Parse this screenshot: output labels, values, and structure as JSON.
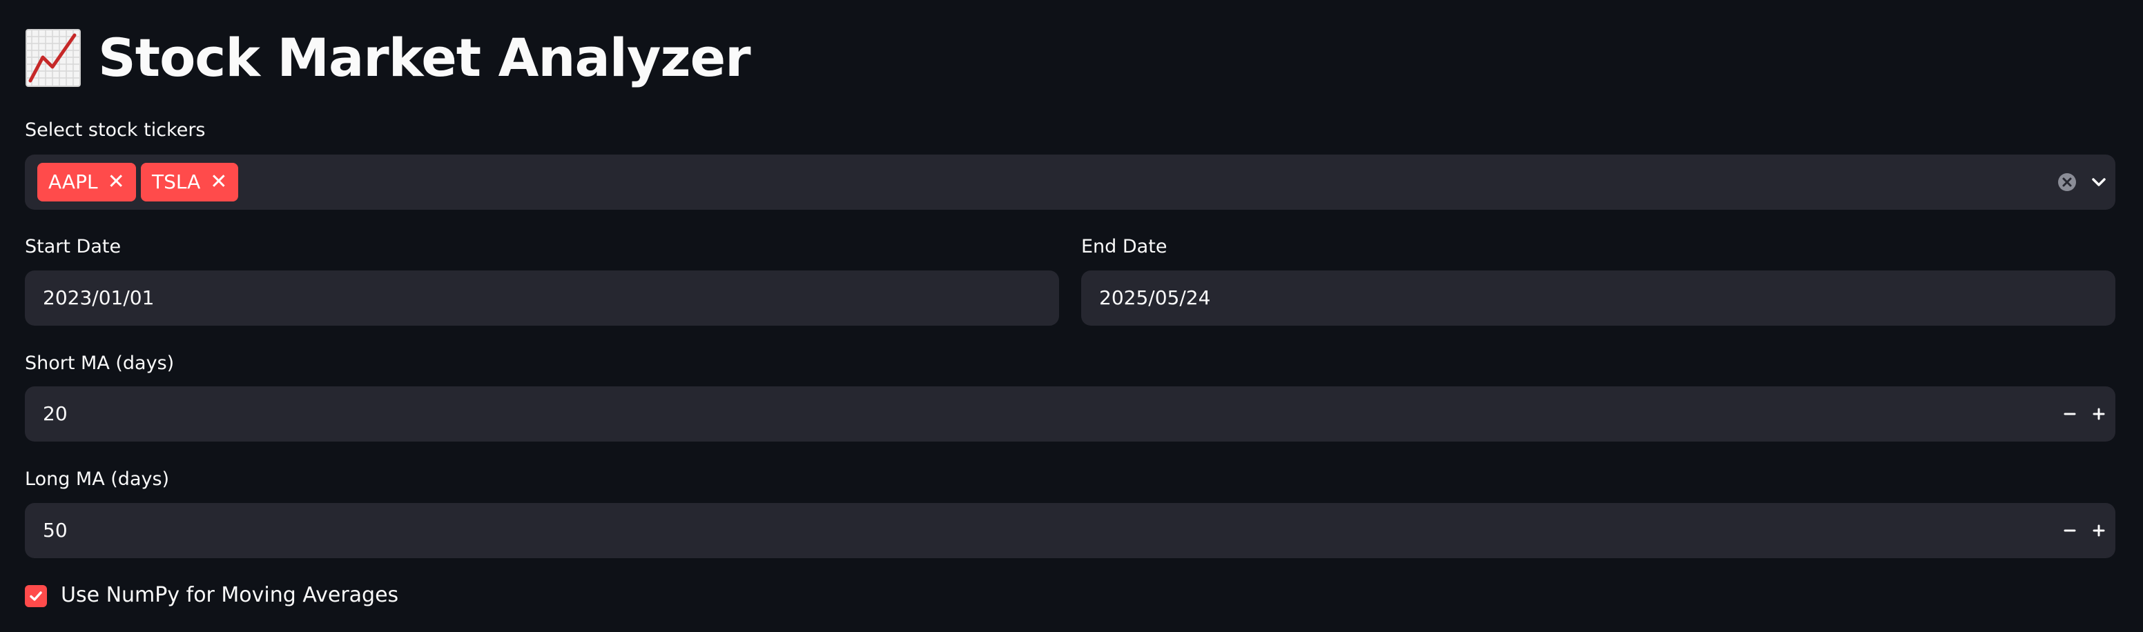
{
  "header": {
    "emoji_icon": "chart-increasing-icon",
    "title": "Stock Market Analyzer"
  },
  "tickers": {
    "label": "Select stock tickers",
    "selected": [
      "AAPL",
      "TSLA"
    ],
    "chip_color": "#ff4b4b"
  },
  "dates": {
    "start_label": "Start Date",
    "start_value": "2023/01/01",
    "end_label": "End Date",
    "end_value": "2025/05/24"
  },
  "short_ma": {
    "label": "Short MA (days)",
    "value": "20"
  },
  "long_ma": {
    "label": "Long MA (days)",
    "value": "50"
  },
  "numpy_option": {
    "label": "Use NumPy for Moving Averages",
    "checked": true
  },
  "theme": {
    "background": "#0e1117",
    "field_background": "#262730",
    "accent": "#ff4b4b",
    "text": "#fafafa"
  }
}
